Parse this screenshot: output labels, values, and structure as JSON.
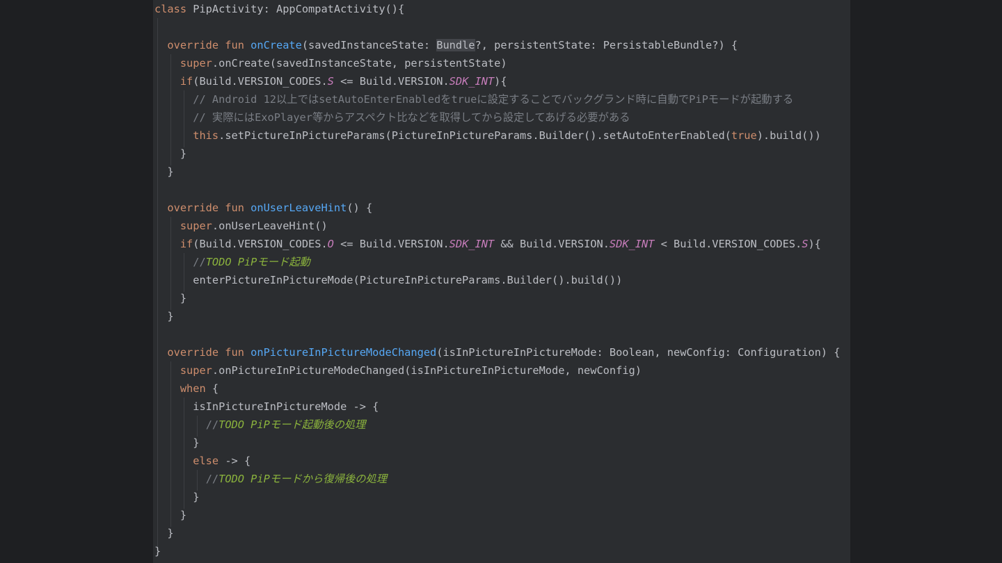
{
  "colors": {
    "page_background": "#1e1f22",
    "editor_background": "#2b2d30",
    "keyword": "#cf8e6d",
    "function": "#56a8f5",
    "text": "#bcbec4",
    "constant": "#c77dbb",
    "comment": "#7a7e85",
    "todo": "#8bb33d",
    "highlight": "#43454a"
  },
  "editor": {
    "language": "kotlin",
    "lines": [
      [
        [
          "kw",
          "class "
        ],
        [
          "plain",
          "PipActivity: AppCompatActivity(){"
        ]
      ],
      [],
      [
        [
          "plain",
          "  "
        ],
        [
          "kw",
          "override fun "
        ],
        [
          "fn",
          "onCreate"
        ],
        [
          "plain",
          "(savedInstanceState: "
        ],
        [
          "hl",
          "Bundle"
        ],
        [
          "plain",
          "?, persistentState: PersistableBundle?) {"
        ]
      ],
      [
        [
          "plain",
          "    "
        ],
        [
          "kw",
          "super"
        ],
        [
          "plain",
          ".onCreate(savedInstanceState, persistentState)"
        ]
      ],
      [
        [
          "plain",
          "    "
        ],
        [
          "kw",
          "if"
        ],
        [
          "plain",
          "(Build.VERSION_CODES."
        ],
        [
          "const",
          "S"
        ],
        [
          "plain",
          " <= Build.VERSION."
        ],
        [
          "const",
          "SDK_INT"
        ],
        [
          "plain",
          "){"
        ]
      ],
      [
        [
          "plain",
          "      "
        ],
        [
          "comment",
          "// Android 12以上ではsetAutoEnterEnabledをtrueに設定することでバックグランド時に自動でPiPモードが起動する"
        ]
      ],
      [
        [
          "plain",
          "      "
        ],
        [
          "comment",
          "// 実際にはExoPlayer等からアスペクト比などを取得してから設定してあげる必要がある"
        ]
      ],
      [
        [
          "plain",
          "      "
        ],
        [
          "kw",
          "this"
        ],
        [
          "plain",
          ".setPictureInPictureParams(PictureInPictureParams.Builder().setAutoEnterEnabled("
        ],
        [
          "kw",
          "true"
        ],
        [
          "plain",
          ").build())"
        ]
      ],
      [
        [
          "plain",
          "    }"
        ]
      ],
      [
        [
          "plain",
          "  }"
        ]
      ],
      [],
      [
        [
          "plain",
          "  "
        ],
        [
          "kw",
          "override fun "
        ],
        [
          "fn",
          "onUserLeaveHint"
        ],
        [
          "plain",
          "() {"
        ]
      ],
      [
        [
          "plain",
          "    "
        ],
        [
          "kw",
          "super"
        ],
        [
          "plain",
          ".onUserLeaveHint()"
        ]
      ],
      [
        [
          "plain",
          "    "
        ],
        [
          "kw",
          "if"
        ],
        [
          "plain",
          "(Build.VERSION_CODES."
        ],
        [
          "const",
          "O"
        ],
        [
          "plain",
          " <= Build.VERSION."
        ],
        [
          "const",
          "SDK_INT"
        ],
        [
          "plain",
          " && Build.VERSION."
        ],
        [
          "const",
          "SDK_INT"
        ],
        [
          "plain",
          " < Build.VERSION_CODES."
        ],
        [
          "const",
          "S"
        ],
        [
          "plain",
          "){"
        ]
      ],
      [
        [
          "plain",
          "      "
        ],
        [
          "comment",
          "//"
        ],
        [
          "todo",
          "TODO PiPモード起動"
        ]
      ],
      [
        [
          "plain",
          "      enterPictureInPictureMode(PictureInPictureParams.Builder().build())"
        ]
      ],
      [
        [
          "plain",
          "    }"
        ]
      ],
      [
        [
          "plain",
          "  }"
        ]
      ],
      [],
      [
        [
          "plain",
          "  "
        ],
        [
          "kw",
          "override fun "
        ],
        [
          "fn",
          "onPictureInPictureModeChanged"
        ],
        [
          "plain",
          "(isInPictureInPictureMode: Boolean, newConfig: Configuration) {"
        ]
      ],
      [
        [
          "plain",
          "    "
        ],
        [
          "kw",
          "super"
        ],
        [
          "plain",
          ".onPictureInPictureModeChanged(isInPictureInPictureMode, newConfig)"
        ]
      ],
      [
        [
          "plain",
          "    "
        ],
        [
          "kw",
          "when"
        ],
        [
          "plain",
          " {"
        ]
      ],
      [
        [
          "plain",
          "      isInPictureInPictureMode -> {"
        ]
      ],
      [
        [
          "plain",
          "        "
        ],
        [
          "comment",
          "//"
        ],
        [
          "todo",
          "TODO PiPモード起動後の処理"
        ]
      ],
      [
        [
          "plain",
          "      }"
        ]
      ],
      [
        [
          "plain",
          "      "
        ],
        [
          "kw",
          "else"
        ],
        [
          "plain",
          " -> {"
        ]
      ],
      [
        [
          "plain",
          "        "
        ],
        [
          "comment",
          "//"
        ],
        [
          "todo",
          "TODO PiPモードから復帰後の処理"
        ]
      ],
      [
        [
          "plain",
          "      }"
        ]
      ],
      [
        [
          "plain",
          "    }"
        ]
      ],
      [
        [
          "plain",
          "  }"
        ]
      ],
      [
        [
          "plain",
          "}"
        ]
      ]
    ]
  }
}
